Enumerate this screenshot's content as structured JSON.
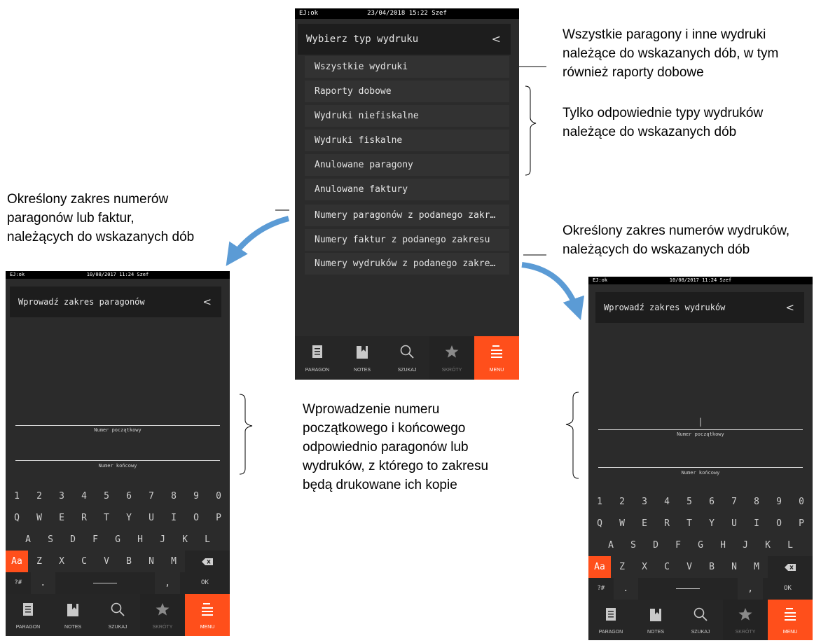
{
  "annotations": {
    "top_right": [
      "Wszystkie paragony i inne wydruki",
      "należące do wskazanych dób, w tym",
      "również raporty dobowe"
    ],
    "mid_right": [
      "Tylko odpowiednie typy wydruków",
      "należące do wskazanych dób"
    ],
    "left_range": [
      "Określony zakres numerów",
      "paragonów lub faktur,",
      "należących do wskazanych dób"
    ],
    "right_range": [
      "Określony zakres numerów wydruków,",
      "należących do wskazanych dób"
    ],
    "center_bottom": [
      "Wprowadzenie numeru",
      "początkowego i końcowego",
      "odpowiednio paragonów lub",
      "wydruków, z którego to zakresu",
      "będą drukowane ich kopie"
    ]
  },
  "center_screen": {
    "status_left": "EJ:ok",
    "status_center": "23/04/2018 15:22 Szef",
    "header_title": "Wybierz typ wydruku",
    "back_glyph": "<",
    "menu_items": [
      "Wszystkie wydruki",
      "Raporty dobowe",
      "Wydruki niefiskalne",
      "Wydruki fiskalne",
      "Anulowane paragony",
      "Anulowane faktury",
      "Numery paragonów z podanego zakr…",
      "Numery faktur z podanego zakresu",
      "Numery wydruków z podanego zakre…"
    ]
  },
  "left_screen": {
    "status_left": "EJ:ok",
    "status_center": "10/08/2017  11:24  Szef",
    "header_title": "Wprowadź zakres paragonów",
    "back_glyph": "<",
    "field_start_label": "Numer początkowy",
    "field_end_label": "Numer końcowy",
    "field_start_value": "",
    "field_end_value": ""
  },
  "right_screen": {
    "status_left": "EJ:ok",
    "status_center": "10/08/2017  11:24  Szef",
    "header_title": "Wprowadź zakres wydruków",
    "back_glyph": "<",
    "field_start_label": "Numer początkowy",
    "field_end_label": "Numer końcowy",
    "field_start_value": "|",
    "field_end_value": ""
  },
  "keyboard": {
    "row1": [
      "1",
      "2",
      "3",
      "4",
      "5",
      "6",
      "7",
      "8",
      "9",
      "0"
    ],
    "row2": [
      "Q",
      "W",
      "E",
      "R",
      "T",
      "Y",
      "U",
      "I",
      "O",
      "P"
    ],
    "row3": [
      "A",
      "S",
      "D",
      "F",
      "G",
      "H",
      "J",
      "K",
      "L"
    ],
    "row4": [
      "Z",
      "X",
      "C",
      "V",
      "B",
      "N",
      "M"
    ],
    "shift": "Aa",
    "symbols": "?#",
    "period": ".",
    "comma": ",",
    "ok": "OK"
  },
  "nav": {
    "items": [
      {
        "label": "PARAGON",
        "icon": "receipt-icon"
      },
      {
        "label": "NOTES",
        "icon": "notebook-icon"
      },
      {
        "label": "SZUKAJ",
        "icon": "search-icon"
      },
      {
        "label": "SKRÓTY",
        "icon": "star-icon"
      },
      {
        "label": "MENU",
        "icon": "menu-icon"
      }
    ]
  },
  "colors": {
    "accent": "#ff4f1b",
    "screen_bg": "#2b2b2b",
    "arrow": "#5b9bd5"
  }
}
